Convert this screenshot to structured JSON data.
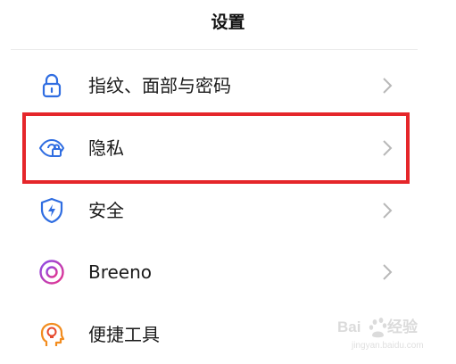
{
  "header": {
    "title": "设置"
  },
  "menu": [
    {
      "label": "指纹、面部与密码",
      "icon": "lock-icon"
    },
    {
      "label": "隐私",
      "icon": "privacy-eye-lock-icon"
    },
    {
      "label": "安全",
      "icon": "shield-icon"
    },
    {
      "label": "Breeno",
      "icon": "breeno-icon"
    },
    {
      "label": "便捷工具",
      "icon": "head-lightbulb-icon"
    }
  ],
  "colors": {
    "icon_blue": "#2f6de1",
    "highlight_red": "#e5262a",
    "chevron_gray": "#b8b8b8",
    "breeno_pink": "#d9368f",
    "tools_orange": "#f28c1e"
  },
  "watermark": {
    "text": "Baidu经验"
  }
}
